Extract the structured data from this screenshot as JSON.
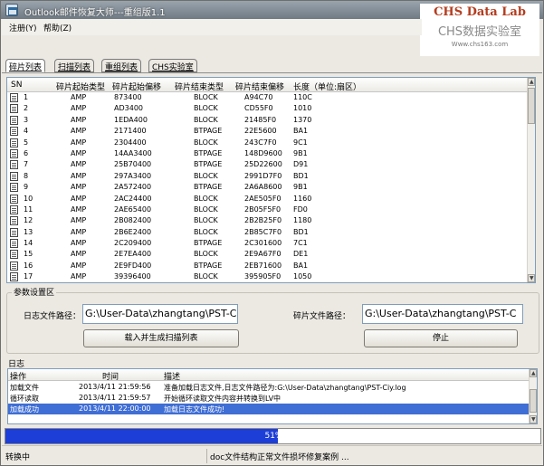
{
  "window": {
    "title": "Outlook邮件恢复大师---重组版1.1"
  },
  "brand": {
    "line1": "CHS Data Lab",
    "line2": "CHS数据实验室",
    "url": "Www.chs163.com"
  },
  "menu": {
    "items": [
      "注册(Y)",
      "帮助(Z)"
    ]
  },
  "tabs": [
    {
      "label": "碎片列表",
      "active": true
    },
    {
      "label": "扫描列表",
      "active": false
    },
    {
      "label": "重组列表",
      "active": false
    },
    {
      "label": "CHS实验室",
      "active": false
    }
  ],
  "fragments": {
    "columns": [
      "SN",
      "碎片起始类型",
      "碎片起始偏移",
      "碎片结束类型",
      "碎片结束偏移",
      "长度（单位:扇区）"
    ],
    "rows": [
      [
        "1",
        "AMP",
        "873400",
        "BLOCK",
        "A94C70",
        "110C"
      ],
      [
        "2",
        "AMP",
        "AD3400",
        "BLOCK",
        "CD55F0",
        "1010"
      ],
      [
        "3",
        "AMP",
        "1EDA400",
        "BLOCK",
        "21485F0",
        "1370"
      ],
      [
        "4",
        "AMP",
        "2171400",
        "BTPAGE",
        "22E5600",
        "BA1"
      ],
      [
        "5",
        "AMP",
        "2304400",
        "BLOCK",
        "243C7F0",
        "9C1"
      ],
      [
        "6",
        "AMP",
        "14AA3400",
        "BTPAGE",
        "148D9600",
        "9B1"
      ],
      [
        "7",
        "AMP",
        "25B70400",
        "BTPAGE",
        "25D22600",
        "D91"
      ],
      [
        "8",
        "AMP",
        "297A3400",
        "BLOCK",
        "2991D7F0",
        "BD1"
      ],
      [
        "9",
        "AMP",
        "2A572400",
        "BTPAGE",
        "2A6A8600",
        "9B1"
      ],
      [
        "10",
        "AMP",
        "2AC24400",
        "BLOCK",
        "2AE505F0",
        "1160"
      ],
      [
        "11",
        "AMP",
        "2AE65400",
        "BLOCK",
        "2B05F5F0",
        "FD0"
      ],
      [
        "12",
        "AMP",
        "2B082400",
        "BLOCK",
        "2B2B25F0",
        "1180"
      ],
      [
        "13",
        "AMP",
        "2B6E2400",
        "BLOCK",
        "2B85C7F0",
        "BD1"
      ],
      [
        "14",
        "AMP",
        "2C209400",
        "BTPAGE",
        "2C301600",
        "7C1"
      ],
      [
        "15",
        "AMP",
        "2E7EA400",
        "BLOCK",
        "2E9A67F0",
        "DE1"
      ],
      [
        "16",
        "AMP",
        "2E9FD400",
        "BTPAGE",
        "2EB71600",
        "BA1"
      ],
      [
        "17",
        "AMP",
        "39396400",
        "BLOCK",
        "395905F0",
        "1050"
      ]
    ]
  },
  "params": {
    "group_title": "参数设置区",
    "log_path_label": "日志文件路径：",
    "log_path_value": "G:\\User-Data\\zhangtang\\PST-Ci",
    "fragment_path_label": "碎片文件路径：",
    "fragment_path_value": "G:\\User-Data\\zhangtang\\PST-C",
    "load_button": "载入并生成扫描列表",
    "stop_button": "停止"
  },
  "log": {
    "group_title": "日志",
    "columns": [
      "操作",
      "时间",
      "描述"
    ],
    "rows": [
      {
        "op": "加载文件",
        "time": "2013/4/11 21:59:56",
        "desc": "准备加载日志文件,日志文件路径为:G:\\User-Data\\zhangtang\\PST-Ciy.log",
        "selected": false
      },
      {
        "op": "循环读取",
        "time": "2013/4/11 21:59:57",
        "desc": "开始循环读取文件内容并转换到LV中",
        "selected": false
      },
      {
        "op": "加载成功",
        "time": "2013/4/11 22:00:00",
        "desc": "加载日志文件成功!",
        "selected": true
      }
    ]
  },
  "progress": {
    "label": "51%",
    "percent": 51
  },
  "status": {
    "left": "转换中",
    "middle": "doc文件结构正常文件损坏修复案例 ..."
  },
  "colors": {
    "progress": "#1d3fd8",
    "selection": "#3f6ed4",
    "brand": "#b43c1e"
  }
}
